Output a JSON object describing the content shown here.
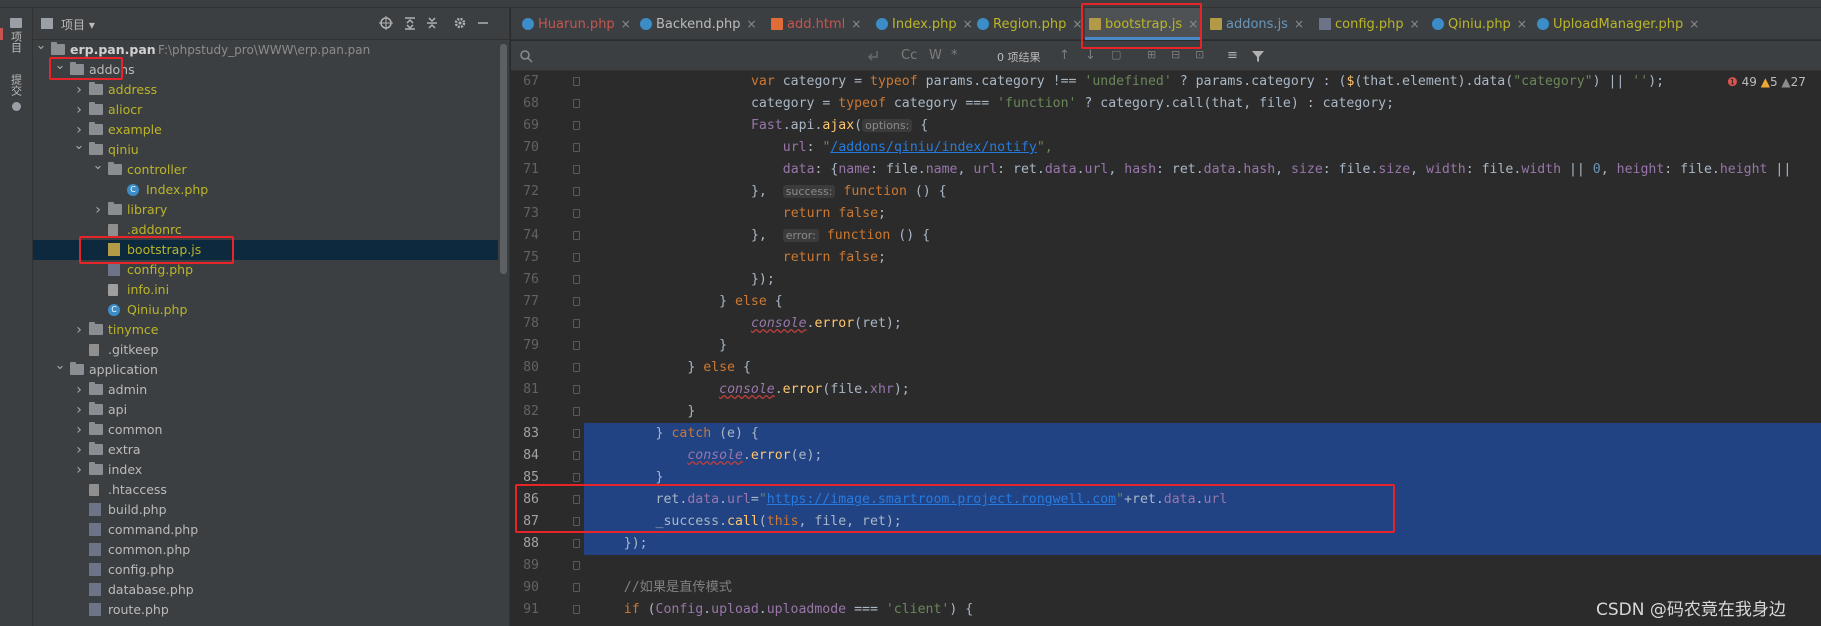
{
  "toolstrip": {
    "items": [
      {
        "label": "项目",
        "icon": "folder-icon"
      },
      {
        "label": "提交",
        "icon": "commit-icon"
      }
    ]
  },
  "project": {
    "title": "项目",
    "tree": [
      {
        "label": "erp.pan.pan",
        "sub": "F:\\phpstudy_pro\\WWW\\erp.pan.pan",
        "depth": 0,
        "type": "folder",
        "arrow": "down",
        "style": "bold"
      },
      {
        "label": "addons",
        "depth": 1,
        "type": "folder",
        "arrow": "down",
        "style": "normal"
      },
      {
        "label": "address",
        "depth": 2,
        "type": "folder",
        "arrow": "right",
        "style": "yellow"
      },
      {
        "label": "aliocr",
        "depth": 2,
        "type": "folder",
        "arrow": "right",
        "style": "yellow"
      },
      {
        "label": "example",
        "depth": 2,
        "type": "folder",
        "arrow": "right",
        "style": "yellow"
      },
      {
        "label": "qiniu",
        "depth": 2,
        "type": "folder",
        "arrow": "down",
        "style": "yellow"
      },
      {
        "label": "controller",
        "depth": 3,
        "type": "folder",
        "arrow": "down",
        "style": "yellow"
      },
      {
        "label": "Index.php",
        "depth": 4,
        "type": "phpc",
        "arrow": "",
        "style": "yellow"
      },
      {
        "label": "library",
        "depth": 3,
        "type": "folder",
        "arrow": "right",
        "style": "yellow"
      },
      {
        "label": ".addonrc",
        "depth": 3,
        "type": "dot",
        "arrow": "",
        "style": "yellow"
      },
      {
        "label": "bootstrap.js",
        "depth": 3,
        "type": "js",
        "arrow": "",
        "style": "yellow",
        "selected": true
      },
      {
        "label": "config.php",
        "depth": 3,
        "type": "phpf",
        "arrow": "",
        "style": "yellow"
      },
      {
        "label": "info.ini",
        "depth": 3,
        "type": "txt",
        "arrow": "",
        "style": "yellow"
      },
      {
        "label": "Qiniu.php",
        "depth": 3,
        "type": "phpc",
        "arrow": "",
        "style": "yellow"
      },
      {
        "label": "tinymce",
        "depth": 2,
        "type": "folder",
        "arrow": "right",
        "style": "yellow"
      },
      {
        "label": ".gitkeep",
        "depth": 2,
        "type": "dot",
        "arrow": "",
        "style": "normal"
      },
      {
        "label": "application",
        "depth": 1,
        "type": "folder",
        "arrow": "down",
        "style": "normal"
      },
      {
        "label": "admin",
        "depth": 2,
        "type": "folder",
        "arrow": "right",
        "style": "normal"
      },
      {
        "label": "api",
        "depth": 2,
        "type": "folder",
        "arrow": "right",
        "style": "normal"
      },
      {
        "label": "common",
        "depth": 2,
        "type": "folder",
        "arrow": "right",
        "style": "normal"
      },
      {
        "label": "extra",
        "depth": 2,
        "type": "folder",
        "arrow": "right",
        "style": "normal"
      },
      {
        "label": "index",
        "depth": 2,
        "type": "folder",
        "arrow": "right",
        "style": "normal"
      },
      {
        "label": ".htaccess",
        "depth": 2,
        "type": "dot",
        "arrow": "",
        "style": "normal"
      },
      {
        "label": "build.php",
        "depth": 2,
        "type": "phpf",
        "arrow": "",
        "style": "normal"
      },
      {
        "label": "command.php",
        "depth": 2,
        "type": "phpf",
        "arrow": "",
        "style": "normal"
      },
      {
        "label": "common.php",
        "depth": 2,
        "type": "phpf",
        "arrow": "",
        "style": "normal"
      },
      {
        "label": "config.php",
        "depth": 2,
        "type": "phpf",
        "arrow": "",
        "style": "normal"
      },
      {
        "label": "database.php",
        "depth": 2,
        "type": "phpf",
        "arrow": "",
        "style": "normal"
      },
      {
        "label": "route.php",
        "depth": 2,
        "type": "phpf",
        "arrow": "",
        "style": "normal"
      }
    ]
  },
  "editor": {
    "tabs": [
      {
        "label": "Huarun.php",
        "icon": "php-class-icon",
        "color": "#c7544f",
        "active": false
      },
      {
        "label": "Backend.php",
        "icon": "php-class-icon",
        "color": "#bbbbbb",
        "active": false
      },
      {
        "label": "add.html",
        "icon": "html-file-icon",
        "color": "#c7544f",
        "active": false
      },
      {
        "label": "Index.php",
        "icon": "php-class-icon",
        "color": "#bbb529",
        "active": false
      },
      {
        "label": "Region.php",
        "icon": "php-class-icon",
        "color": "#bbb529",
        "active": false
      },
      {
        "label": "bootstrap.js",
        "icon": "js-file-icon",
        "color": "#bbb529",
        "active": true
      },
      {
        "label": "addons.js",
        "icon": "js-file-icon",
        "color": "#6897bb",
        "active": false
      },
      {
        "label": "config.php",
        "icon": "php-file-icon",
        "color": "#bbb529",
        "active": false
      },
      {
        "label": "Qiniu.php",
        "icon": "php-class-icon",
        "color": "#bbb529",
        "active": false
      },
      {
        "label": "UploadManager.php",
        "icon": "php-class-icon",
        "color": "#bbb529",
        "active": false
      }
    ],
    "find": {
      "match_case": "Cc",
      "words": "W",
      "regex": "*",
      "results": "0 项结果"
    },
    "inspections": {
      "errors": "49",
      "warnings": "5",
      "weak": "27"
    },
    "lines": [
      {
        "n": "67",
        "hl": false,
        "indent": 21
      },
      {
        "n": "68",
        "hl": false,
        "indent": 21
      },
      {
        "n": "69",
        "hl": false,
        "indent": 21
      },
      {
        "n": "70",
        "hl": false,
        "indent": 25
      },
      {
        "n": "71",
        "hl": false,
        "indent": 25
      },
      {
        "n": "72",
        "hl": false,
        "indent": 21
      },
      {
        "n": "73",
        "hl": false,
        "indent": 25
      },
      {
        "n": "74",
        "hl": false,
        "indent": 21
      },
      {
        "n": "75",
        "hl": false,
        "indent": 25
      },
      {
        "n": "76",
        "hl": false,
        "indent": 21
      },
      {
        "n": "77",
        "hl": false,
        "indent": 17
      },
      {
        "n": "78",
        "hl": false,
        "indent": 21
      },
      {
        "n": "79",
        "hl": false,
        "indent": 17
      },
      {
        "n": "80",
        "hl": false,
        "indent": 13
      },
      {
        "n": "81",
        "hl": false,
        "indent": 17
      },
      {
        "n": "82",
        "hl": false,
        "indent": 13
      },
      {
        "n": "83",
        "hl": true,
        "indent": 9
      },
      {
        "n": "84",
        "hl": true,
        "indent": 13
      },
      {
        "n": "85",
        "hl": true,
        "indent": 9
      },
      {
        "n": "86",
        "hl": true,
        "indent": 9
      },
      {
        "n": "87",
        "hl": true,
        "indent": 9
      },
      {
        "n": "88",
        "hl": true,
        "indent": 5
      },
      {
        "n": "89",
        "hl": false,
        "indent": 0
      },
      {
        "n": "90",
        "hl": false,
        "indent": 5
      },
      {
        "n": "91",
        "hl": false,
        "indent": 5
      }
    ]
  },
  "code": {
    "l67": [
      "var",
      " category = ",
      "typeof",
      " params.category !== ",
      "'undefined'",
      " ? params.category : (",
      "$",
      "(that.element).data(",
      "\"category\"",
      ") || ",
      "''",
      ");"
    ],
    "l68": [
      "category = ",
      "typeof",
      " category === ",
      "'function'",
      " ? category.call(that, file) : category;"
    ],
    "l69": [
      "Fast",
      ".api.",
      "ajax",
      "(",
      "options:",
      " {"
    ],
    "l70": [
      "url",
      ": ",
      "\"",
      "/addons/qiniu/index/notify",
      "\","
    ],
    "l71": [
      "data",
      ": {",
      "name",
      ": file.",
      "name",
      ", ",
      "url",
      ": ret.",
      "data",
      ".",
      "url",
      ", ",
      "hash",
      ": ret.",
      "data",
      ".",
      "hash",
      ", ",
      "size",
      ": file.",
      "size",
      ", ",
      "width",
      ": file.",
      "width",
      " || ",
      "0",
      ", ",
      "height",
      ": file.",
      "height",
      " ||"
    ],
    "l72": [
      "},  ",
      "success:",
      " ",
      "function",
      " () {"
    ],
    "l73": [
      "return",
      " ",
      "false",
      ";"
    ],
    "l74": [
      "},  ",
      "error:",
      " ",
      "function",
      " () {"
    ],
    "l75": [
      "return",
      " ",
      "false",
      ";"
    ],
    "l76": [
      "});"
    ],
    "l77": [
      "} ",
      "else",
      " {"
    ],
    "l78": [
      "console",
      ".",
      "error",
      "(ret);"
    ],
    "l79": [
      "}"
    ],
    "l80": [
      "} ",
      "else",
      " {"
    ],
    "l81": [
      "console",
      ".",
      "error",
      "(file.",
      "xhr",
      ");"
    ],
    "l82": [
      "}"
    ],
    "l83": [
      "} ",
      "catch",
      " (e) {"
    ],
    "l84": [
      "console",
      ".",
      "error",
      "(e);"
    ],
    "l85": [
      "}"
    ],
    "l86": [
      "ret.",
      "data",
      ".",
      "url",
      "=",
      "\"",
      "https://image.smartroom.project.rongwell.com",
      "\"",
      "+ret.",
      "data",
      ".",
      "url"
    ],
    "l87": [
      "_success",
      ".",
      "call",
      "(",
      "this",
      ", file, ret);"
    ],
    "l88": [
      "});"
    ],
    "l89": [
      ""
    ],
    "l90": [
      "//如果是直传模式"
    ],
    "l91": [
      "if",
      " (",
      "Config",
      ".",
      "upload",
      ".",
      "uploadmode",
      " === ",
      "'client'",
      ") {"
    ]
  },
  "watermark": "CSDN @码农竟在我身边"
}
